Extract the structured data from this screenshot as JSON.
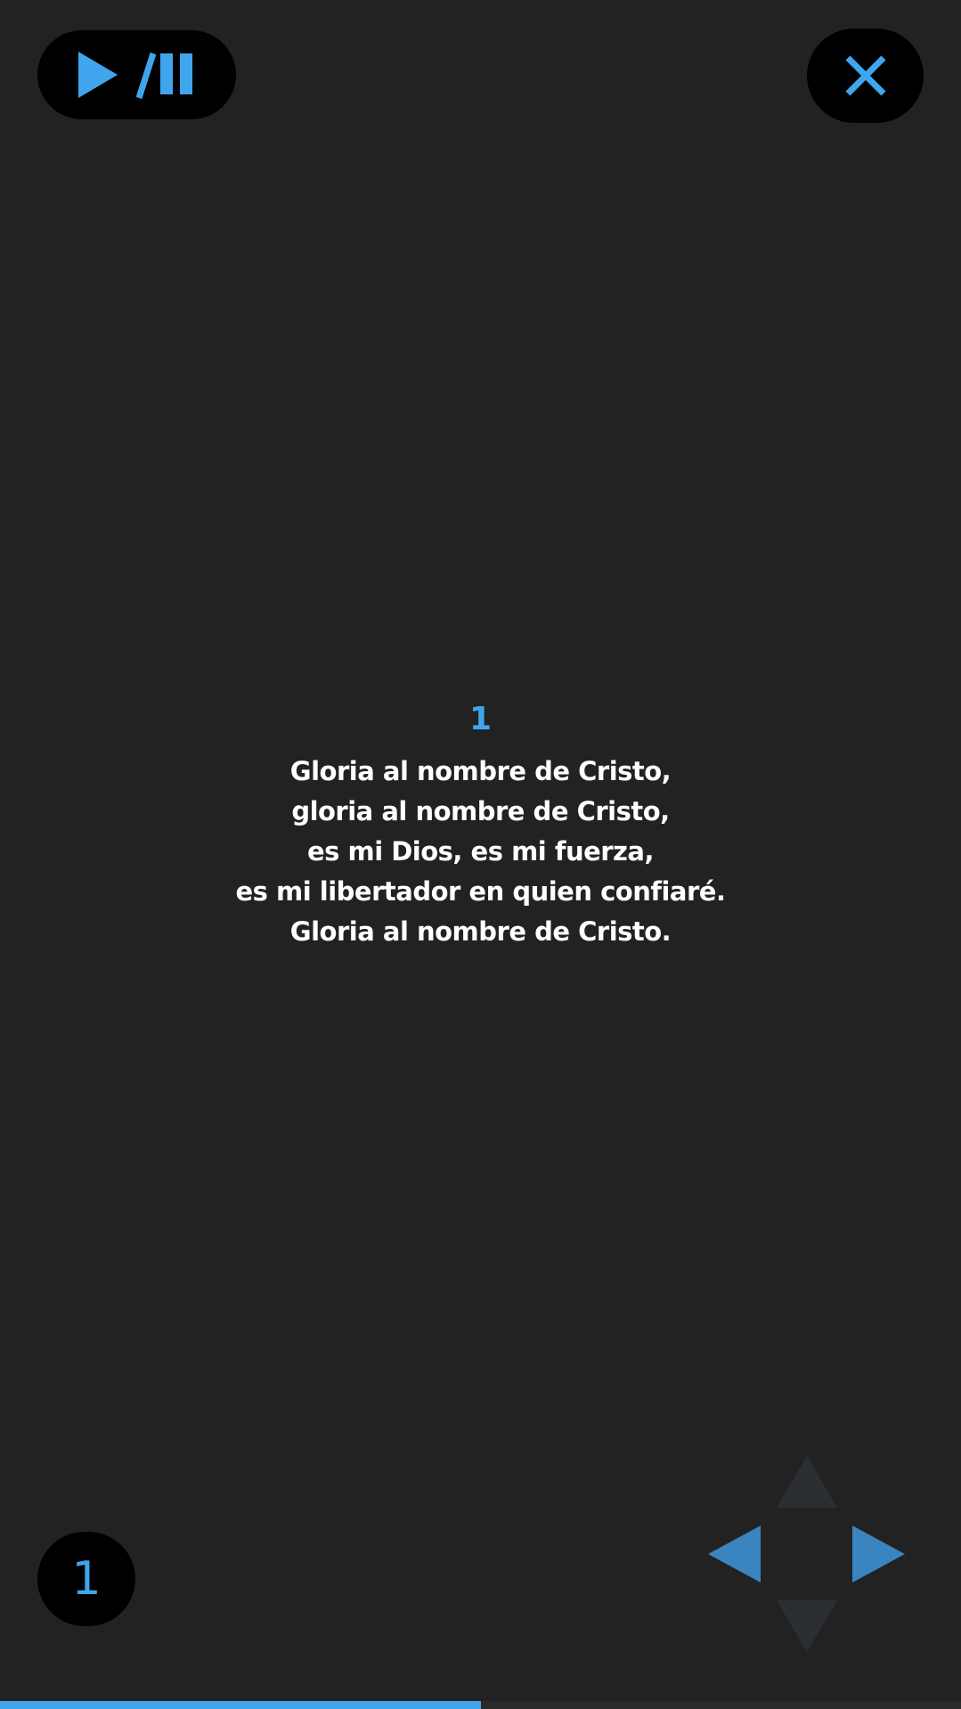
{
  "controls": {
    "play_pause_icon": "play-pause-icon",
    "close_icon": "close-icon",
    "accent_color": "#3fa6ee"
  },
  "song": {
    "verse_number": "1",
    "lines": [
      "Gloria al nombre de Cristo,",
      "gloria al nombre de Cristo,",
      "es mi Dios, es mi fuerza,",
      "es mi libertador en quien confiaré.",
      "Gloria al nombre de Cristo."
    ]
  },
  "footer": {
    "current_verse": "1",
    "progress": 0.5
  },
  "nav": {
    "up_enabled": false,
    "down_enabled": false,
    "left_enabled": true,
    "right_enabled": true
  }
}
